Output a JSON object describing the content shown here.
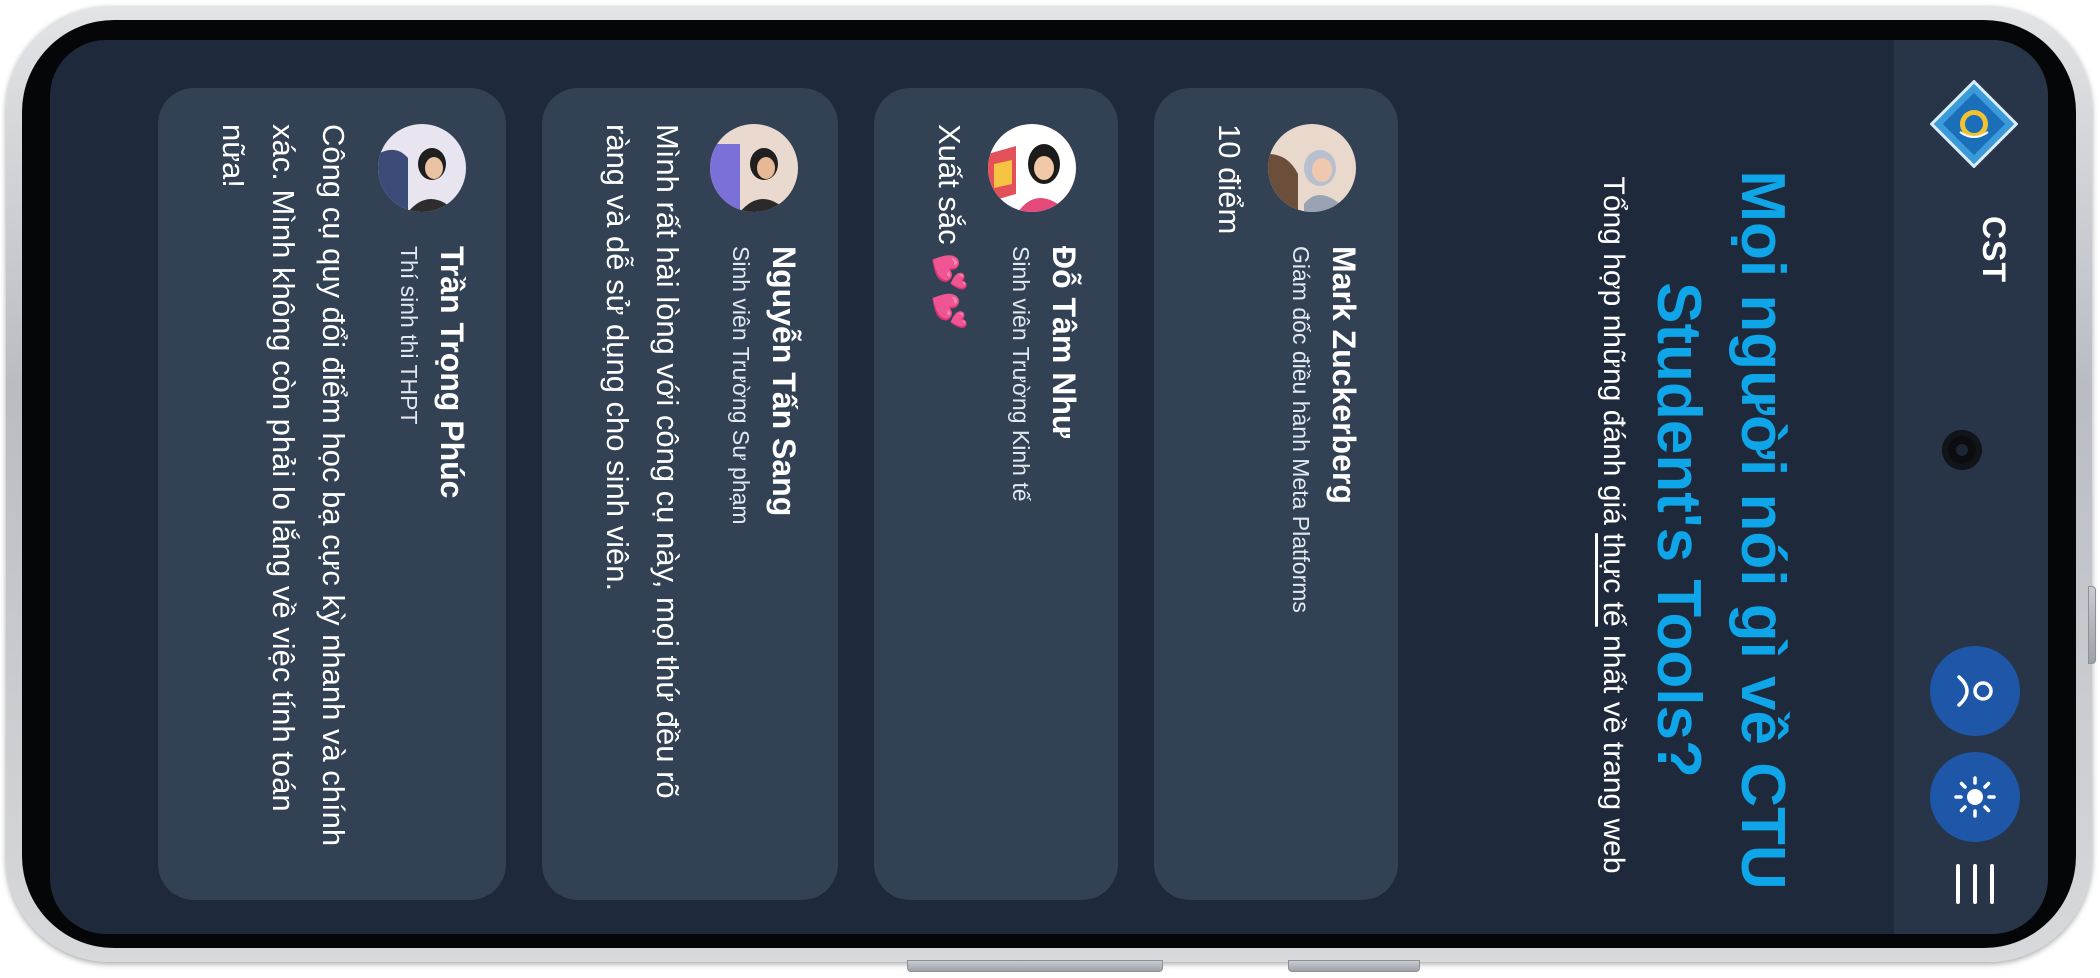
{
  "brand": {
    "name": "CST"
  },
  "heading": {
    "title": "Mọi người nói gì về CTU Student's Tools?",
    "subtitle_before": "Tổng hợp những đánh giá ",
    "subtitle_highlight": "thực tế",
    "subtitle_after": " nhất về trang web"
  },
  "testimonials": [
    {
      "name": "Mark Zuckerberg",
      "role": "Giám đốc điều hành Meta Platforms",
      "review": "10 điểm"
    },
    {
      "name": "Đỗ Tâm Như",
      "role": "Sinh viên Trường Kinh tế",
      "review": "Xuất sắc 💕💕"
    },
    {
      "name": "Nguyễn Tấn Sang",
      "role": "Sinh viên Trường Sư phạm",
      "review": "Mình rất hài lòng với công cụ này, mọi thứ đều rõ ràng và dễ sử dụng cho sinh viên."
    },
    {
      "name": "Trần Trọng Phúc",
      "role": "Thí sinh thi THPT",
      "review": "Công cụ quy đổi điểm học bạ cực kỳ nhanh và chính xác. Mình không còn phải lo lắng về việc tính toán nữa!"
    }
  ],
  "icons": {
    "logo": "ctu-logo-icon",
    "user": "user-icon",
    "theme": "sun-icon",
    "menu": "menu-icon"
  },
  "colors": {
    "screen_bg": "#1e293b",
    "card_bg": "#334155",
    "nav_bg": "#283548",
    "accent": "#0ea5e9",
    "button_bg": "#1e56a8"
  }
}
